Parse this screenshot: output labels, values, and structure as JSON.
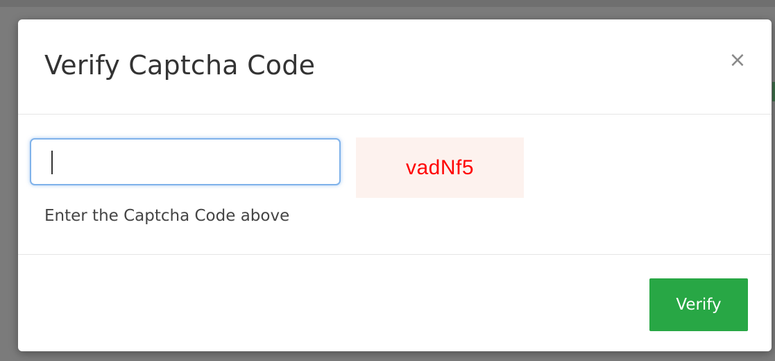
{
  "modal": {
    "title": "Verify Captcha Code",
    "close_label": "×"
  },
  "form": {
    "captcha_input_value": "",
    "captcha_code": "vadNf5",
    "help_text": "Enter the Captcha Code above"
  },
  "footer": {
    "verify_label": "Verify"
  },
  "colors": {
    "verify_button": "#28a745",
    "captcha_code_text": "#ff0000",
    "captcha_code_background": "#fdf2ee",
    "input_focus_border": "#7fb2ea"
  },
  "icons": {
    "close": "close-icon"
  }
}
